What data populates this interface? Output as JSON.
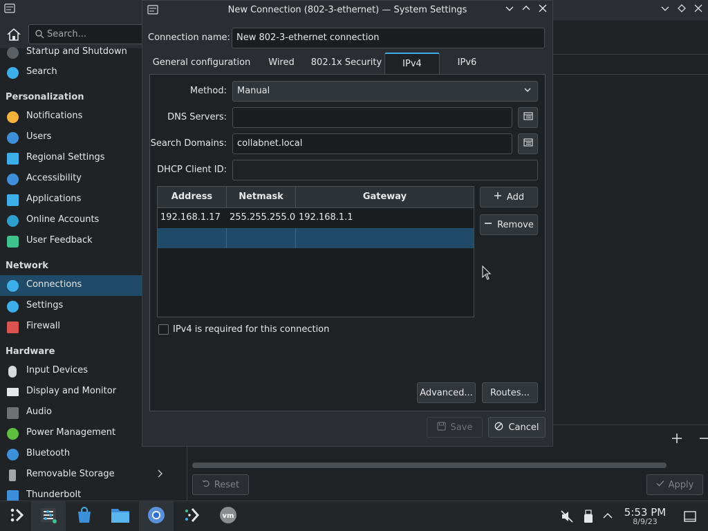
{
  "background": {
    "search_placeholder": "Search...",
    "sidebar": {
      "items_top": [
        {
          "label": "Startup and Shutdown",
          "icon": "power-settings-icon"
        },
        {
          "label": "Search",
          "icon": "search-icon"
        }
      ],
      "section_personalization": "Personalization",
      "items_personalization": [
        {
          "label": "Notifications",
          "icon": "bell-icon"
        },
        {
          "label": "Users",
          "icon": "users-icon"
        },
        {
          "label": "Regional Settings",
          "icon": "regional-icon"
        },
        {
          "label": "Accessibility",
          "icon": "accessibility-icon"
        },
        {
          "label": "Applications",
          "icon": "applications-icon"
        },
        {
          "label": "Online Accounts",
          "icon": "online-accounts-icon"
        },
        {
          "label": "User Feedback",
          "icon": "feedback-icon"
        }
      ],
      "section_network": "Network",
      "items_network": [
        {
          "label": "Connections",
          "icon": "globe-icon"
        },
        {
          "label": "Settings",
          "icon": "globe-icon"
        },
        {
          "label": "Firewall",
          "icon": "firewall-icon"
        }
      ],
      "section_hardware": "Hardware",
      "items_hardware": [
        {
          "label": "Input Devices",
          "icon": "mouse-icon"
        },
        {
          "label": "Display and Monitor",
          "icon": "monitor-icon"
        },
        {
          "label": "Audio",
          "icon": "speaker-icon"
        },
        {
          "label": "Power Management",
          "icon": "battery-icon"
        },
        {
          "label": "Bluetooth",
          "icon": "bluetooth-icon"
        },
        {
          "label": "Removable Storage",
          "icon": "usb-icon"
        },
        {
          "label": "Thunderbolt",
          "icon": "thunderbolt-icon"
        }
      ]
    },
    "reset_label": "Reset",
    "apply_label": "Apply"
  },
  "dialog": {
    "title": "New Connection (802-3-ethernet) — System Settings",
    "connection_name_label": "Connection name:",
    "connection_name_value": "New 802-3-ethernet connection",
    "tabs": [
      {
        "label": "General configuration"
      },
      {
        "label": "Wired"
      },
      {
        "label": "802.1x Security"
      },
      {
        "label": "IPv4"
      },
      {
        "label": "IPv6"
      }
    ],
    "active_tab": "IPv4",
    "method_label": "Method:",
    "method_value": "Manual",
    "dns_label": "DNS Servers:",
    "dns_value": "",
    "search_domains_label": "Search Domains:",
    "search_domains_value": "collabnet.local",
    "dhcp_label": "DHCP Client ID:",
    "dhcp_value": "",
    "table": {
      "headers": [
        "Address",
        "Netmask",
        "Gateway"
      ],
      "rows": [
        [
          "192.168.1.17",
          "255.255.255.0",
          "192.168.1.1"
        ]
      ]
    },
    "add_label": "Add",
    "remove_label": "Remove",
    "required_label": "IPv4 is required for this connection",
    "required_checked": false,
    "advanced_label": "Advanced...",
    "routes_label": "Routes...",
    "save_label": "Save",
    "cancel_label": "Cancel"
  },
  "taskbar": {
    "apps": [
      {
        "icon": "app-launcher-icon"
      },
      {
        "icon": "system-settings-icon"
      },
      {
        "icon": "discover-store-icon"
      },
      {
        "icon": "file-manager-icon"
      },
      {
        "icon": "chromium-icon"
      },
      {
        "icon": "kde-connect-icon"
      },
      {
        "icon": "vmware-icon"
      }
    ],
    "time": "5:53 PM",
    "date": "8/9/23"
  },
  "colors": {
    "accent": "#3daee9",
    "selection": "#1f4a68",
    "window_bg": "#2a2e32",
    "field_bg": "#1b1e20"
  }
}
